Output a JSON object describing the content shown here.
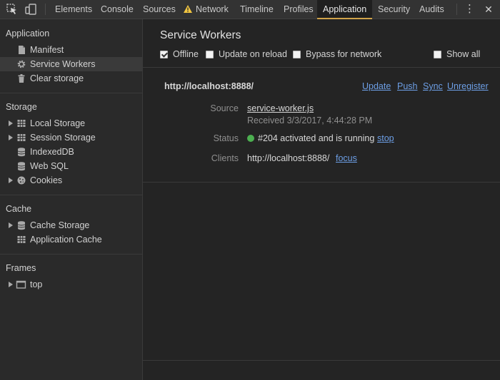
{
  "toolbar": {
    "tabs": [
      {
        "label": "Elements"
      },
      {
        "label": "Console"
      },
      {
        "label": "Sources"
      },
      {
        "label": "Network"
      },
      {
        "label": "Timeline"
      },
      {
        "label": "Profiles"
      },
      {
        "label": "Application"
      },
      {
        "label": "Security"
      },
      {
        "label": "Audits"
      }
    ],
    "active_tab": "Application",
    "close_glyph": "✕",
    "menu_glyph": "⋮",
    "accent_color": "#d0a34a"
  },
  "sidebar": {
    "sections": [
      {
        "title": "Application",
        "items": [
          {
            "label": "Manifest",
            "icon": "file-icon"
          },
          {
            "label": "Service Workers",
            "icon": "gear-icon"
          },
          {
            "label": "Clear storage",
            "icon": "trash-icon"
          }
        ]
      },
      {
        "title": "Storage",
        "items": [
          {
            "label": "Local Storage",
            "icon": "grid-icon"
          },
          {
            "label": "Session Storage",
            "icon": "grid-icon"
          },
          {
            "label": "IndexedDB",
            "icon": "database-icon"
          },
          {
            "label": "Web SQL",
            "icon": "database-icon"
          },
          {
            "label": "Cookies",
            "icon": "cookie-icon"
          }
        ]
      },
      {
        "title": "Cache",
        "items": [
          {
            "label": "Cache Storage",
            "icon": "database-icon"
          },
          {
            "label": "Application Cache",
            "icon": "grid-icon"
          }
        ]
      },
      {
        "title": "Frames",
        "items": [
          {
            "label": "top",
            "icon": "frame-icon"
          }
        ]
      }
    ],
    "selected_item": "Service Workers"
  },
  "main": {
    "title": "Service Workers",
    "options": {
      "offline": {
        "label": "Offline",
        "checked": true
      },
      "update_on_reload": {
        "label": "Update on reload",
        "checked": false
      },
      "bypass_for_network": {
        "label": "Bypass for network",
        "checked": false
      },
      "show_all": {
        "label": "Show all",
        "checked": false
      }
    },
    "worker": {
      "origin": "http://localhost:8888/",
      "actions": {
        "update": "Update",
        "push": "Push",
        "sync": "Sync",
        "unregister": "Unregister"
      },
      "source_label": "Source",
      "source_file": "service-worker.js",
      "received": "Received 3/3/2017, 4:44:28 PM",
      "status_label": "Status",
      "status_text": "#204 activated and is running",
      "status_color": "#4caf50",
      "stop_label": "stop",
      "clients_label": "Clients",
      "client_url": "http://localhost:8888/",
      "focus_label": "focus"
    }
  }
}
